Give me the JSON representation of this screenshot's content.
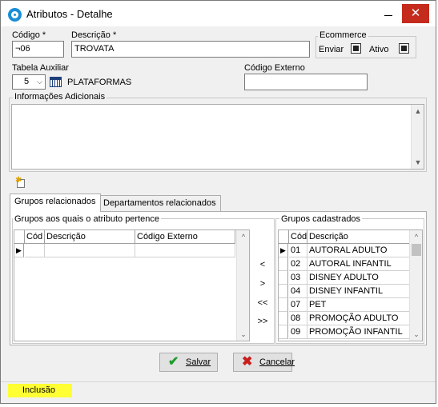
{
  "window": {
    "title": "Atributos - Detalhe",
    "close_glyph": "✕"
  },
  "fields": {
    "codigo_label": "Código *",
    "codigo_value": "¬06",
    "descricao_label": "Descrição *",
    "descricao_value": "TROVATA",
    "tabela_label": "Tabela Auxiliar",
    "tabela_value": "5",
    "tabela_text": "PLATAFORMAS",
    "codigo_externo_label": "Código Externo",
    "codigo_externo_value": "",
    "info_label": "Informações Adicionais",
    "info_value": ""
  },
  "ecommerce": {
    "title": "Ecommerce",
    "enviar_label": "Enviar",
    "enviar_checked": true,
    "ativo_label": "Ativo",
    "ativo_checked": true
  },
  "tabs": [
    {
      "label": "Grupos relacionados",
      "active": true
    },
    {
      "label": "Departamentos relacionados",
      "active": false
    }
  ],
  "left_grid": {
    "title": "Grupos aos quais o atributo pertence",
    "columns": [
      "Cód",
      "Descrição",
      "Código Externo"
    ],
    "current_row_marker": "▶"
  },
  "transfer_buttons": [
    "<",
    ">",
    "<<",
    ">>"
  ],
  "right_grid": {
    "title": "Grupos cadastrados",
    "columns": [
      "Cód",
      "Descrição"
    ],
    "current_row_marker": "▶",
    "rows": [
      {
        "cod": "01",
        "desc": "AUTORAL ADULTO"
      },
      {
        "cod": "02",
        "desc": "AUTORAL INFANTIL"
      },
      {
        "cod": "03",
        "desc": "DISNEY ADULTO"
      },
      {
        "cod": "04",
        "desc": "DISNEY INFANTIL"
      },
      {
        "cod": "07",
        "desc": "PET"
      },
      {
        "cod": "08",
        "desc": "PROMOÇÃO ADULTO"
      },
      {
        "cod": "09",
        "desc": "PROMOÇÃO INFANTIL"
      }
    ]
  },
  "buttons": {
    "salvar": "Salvar",
    "cancelar": "Cancelar"
  },
  "status": {
    "mode": "Inclusão"
  },
  "colors": {
    "status_bg": "#ffff33",
    "close_bg": "#c42b1c",
    "save_check": "#1e9a2e",
    "cancel_x": "#c81e1e"
  },
  "icons": [
    "app-logo-icon",
    "minimize-icon",
    "close-icon",
    "calendar-table-icon",
    "new-document-icon",
    "check-icon",
    "x-icon",
    "row-pointer-icon"
  ]
}
